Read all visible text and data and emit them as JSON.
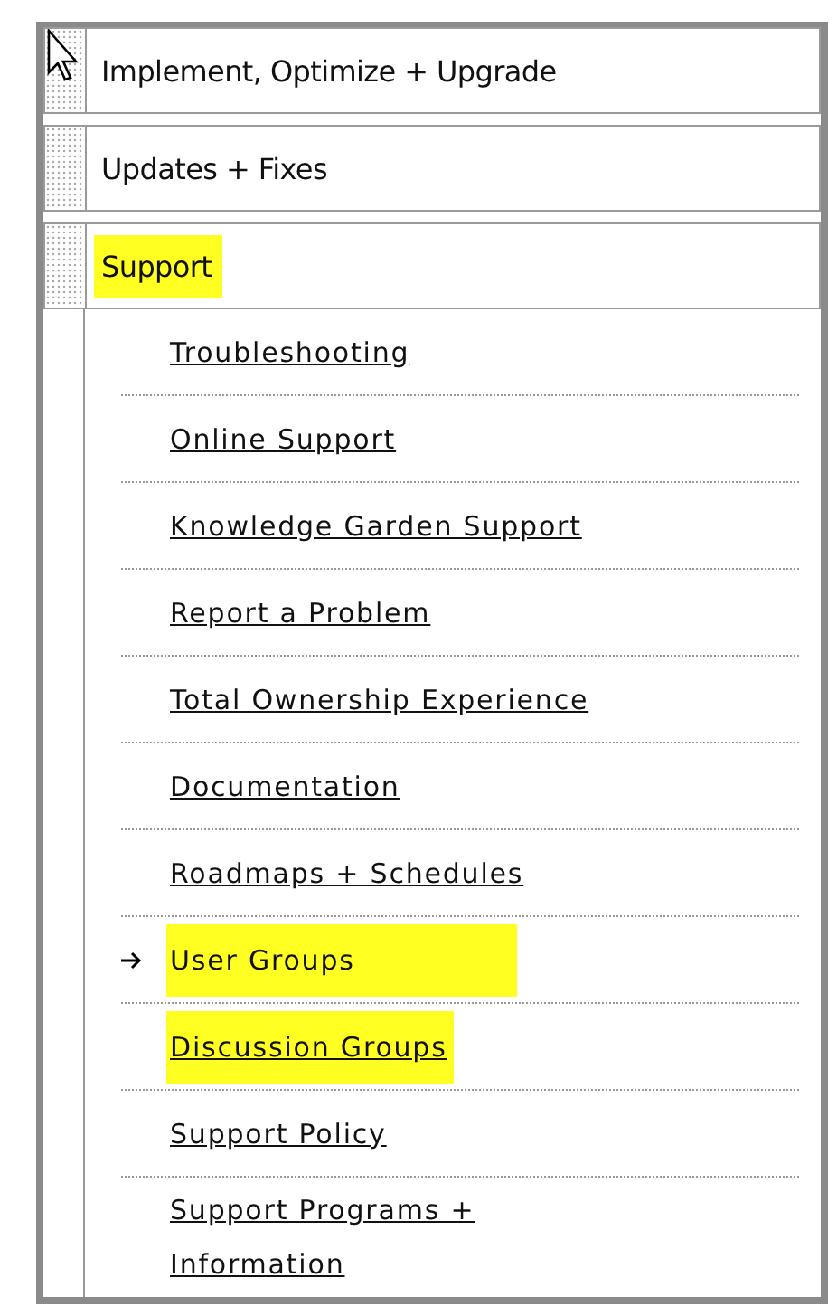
{
  "sections": [
    {
      "label": "Implement, Optimize + Upgrade",
      "highlighted": false
    },
    {
      "label": "Updates + Fixes",
      "highlighted": false
    },
    {
      "label": "Support",
      "highlighted": true
    }
  ],
  "subitems": [
    {
      "label": "Troubleshooting",
      "highlighted": false,
      "current": false
    },
    {
      "label": "Online Support",
      "highlighted": false,
      "current": false
    },
    {
      "label": "Knowledge Garden Support",
      "highlighted": false,
      "current": false
    },
    {
      "label": "Report a Problem",
      "highlighted": false,
      "current": false
    },
    {
      "label": "Total Ownership Experience",
      "highlighted": false,
      "current": false
    },
    {
      "label": "Documentation",
      "highlighted": false,
      "current": false
    },
    {
      "label": "Roadmaps + Schedules",
      "highlighted": false,
      "current": false
    },
    {
      "label": "User Groups",
      "highlighted": true,
      "current": true
    },
    {
      "label": "Discussion Groups",
      "highlighted": true,
      "current": false
    },
    {
      "label": "Support Policy",
      "highlighted": false,
      "current": false
    },
    {
      "label": "Support Programs + Information",
      "highlighted": false,
      "current": false
    }
  ]
}
